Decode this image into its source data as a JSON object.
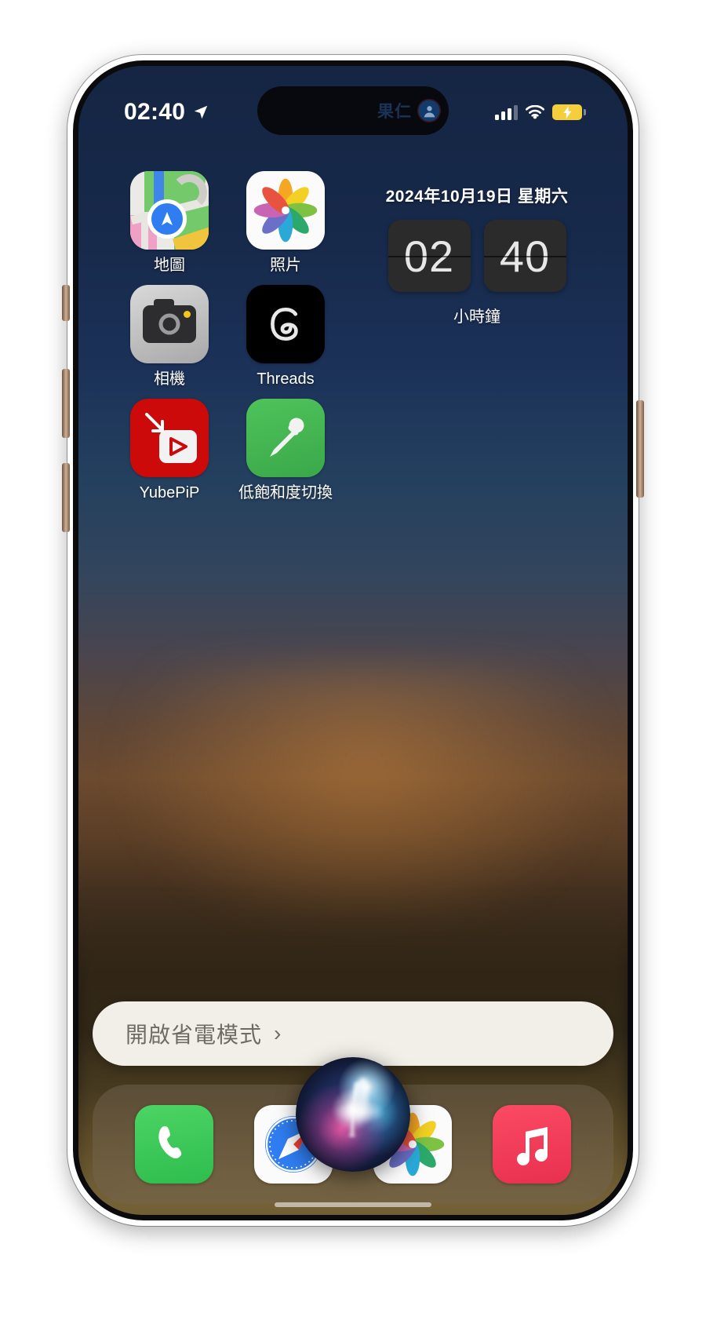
{
  "device": {
    "name": "iPhone 15 Pro",
    "frame_color": "#b08a6a"
  },
  "status_bar": {
    "time": "02:40",
    "location_icon": "location-arrow-icon",
    "cellular_icon": "cellular-signal-icon",
    "wifi_icon": "wifi-icon",
    "battery_icon": "battery-charging-icon",
    "battery_color": "#f5cf3b",
    "battery_state": "charging-low-power-mode"
  },
  "dynamic_island": {
    "text": "果仁",
    "avatar_icon": "contact-avatar-icon"
  },
  "home_screen": {
    "apps": [
      {
        "label": "地圖",
        "icon": "maps-icon"
      },
      {
        "label": "照片",
        "icon": "photos-icon"
      },
      {
        "label": "相機",
        "icon": "camera-icon"
      },
      {
        "label": "Threads",
        "icon": "threads-icon"
      },
      {
        "label": "YubePiP",
        "icon": "yubepip-icon"
      },
      {
        "label": "低飽和度切換",
        "icon": "eyedropper-icon"
      }
    ]
  },
  "clock_widget": {
    "date": "2024年10月19日 星期六",
    "hours": "02",
    "minutes": "40",
    "label": "小時鐘",
    "tile_color": "#2b2b2b"
  },
  "siri_suggestion": {
    "text": "開啟省電模式",
    "chevron": "›",
    "background": "#f2efe9"
  },
  "dock": {
    "apps": [
      {
        "label": "電話",
        "icon": "phone-icon",
        "color": "#2ebd4e"
      },
      {
        "label": "Safari",
        "icon": "safari-icon",
        "color": "#2f7df0"
      },
      {
        "label": "照片",
        "icon": "photos-icon",
        "color": "#ffffff"
      },
      {
        "label": "音樂",
        "icon": "music-icon",
        "color": "#e8304f"
      }
    ]
  },
  "siri_orb": {
    "icon": "siri-orb-icon",
    "state": "listening"
  }
}
